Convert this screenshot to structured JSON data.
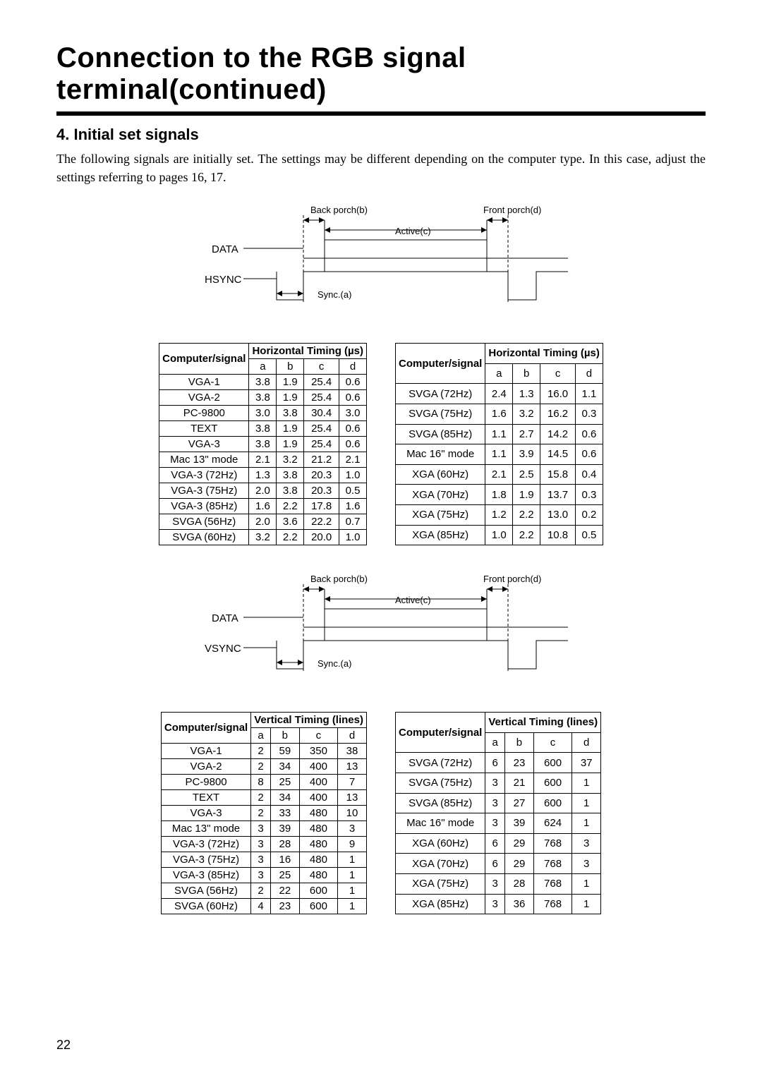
{
  "title": "Connection to the RGB signal terminal(continued)",
  "section_heading": "4. Initial set signals",
  "description": "The following signals are initially set. The settings may be different depending on the computer type. In this case, adjust the settings referring to pages 16, 17.",
  "page_number": "22",
  "diagram": {
    "back_porch": "Back porch(b)",
    "front_porch": "Front porch(d)",
    "active": "Active(c)",
    "sync": "Sync.(a)",
    "data_label": "DATA",
    "hsync_label": "HSYNC",
    "vsync_label": "VSYNC"
  },
  "tables": {
    "sig_header": "Computer/signal",
    "horiz_header": "Horizontal Timing (µs)",
    "vert_header": "Vertical Timing (lines)",
    "cols": [
      "a",
      "b",
      "c",
      "d"
    ],
    "horiz_left": [
      {
        "name": "VGA-1",
        "v": [
          "3.8",
          "1.9",
          "25.4",
          "0.6"
        ]
      },
      {
        "name": "VGA-2",
        "v": [
          "3.8",
          "1.9",
          "25.4",
          "0.6"
        ]
      },
      {
        "name": "PC-9800",
        "v": [
          "3.0",
          "3.8",
          "30.4",
          "3.0"
        ]
      },
      {
        "name": "TEXT",
        "v": [
          "3.8",
          "1.9",
          "25.4",
          "0.6"
        ]
      },
      {
        "name": "VGA-3",
        "v": [
          "3.8",
          "1.9",
          "25.4",
          "0.6"
        ]
      },
      {
        "name": "Mac 13\" mode",
        "v": [
          "2.1",
          "3.2",
          "21.2",
          "2.1"
        ]
      },
      {
        "name": "VGA-3 (72Hz)",
        "v": [
          "1.3",
          "3.8",
          "20.3",
          "1.0"
        ]
      },
      {
        "name": "VGA-3 (75Hz)",
        "v": [
          "2.0",
          "3.8",
          "20.3",
          "0.5"
        ]
      },
      {
        "name": "VGA-3 (85Hz)",
        "v": [
          "1.6",
          "2.2",
          "17.8",
          "1.6"
        ]
      },
      {
        "name": "SVGA (56Hz)",
        "v": [
          "2.0",
          "3.6",
          "22.2",
          "0.7"
        ]
      },
      {
        "name": "SVGA (60Hz)",
        "v": [
          "3.2",
          "2.2",
          "20.0",
          "1.0"
        ]
      }
    ],
    "horiz_right": [
      {
        "name": "SVGA (72Hz)",
        "v": [
          "2.4",
          "1.3",
          "16.0",
          "1.1"
        ]
      },
      {
        "name": "SVGA (75Hz)",
        "v": [
          "1.6",
          "3.2",
          "16.2",
          "0.3"
        ]
      },
      {
        "name": "SVGA (85Hz)",
        "v": [
          "1.1",
          "2.7",
          "14.2",
          "0.6"
        ]
      },
      {
        "name": "Mac 16\" mode",
        "v": [
          "1.1",
          "3.9",
          "14.5",
          "0.6"
        ]
      },
      {
        "name": "XGA (60Hz)",
        "v": [
          "2.1",
          "2.5",
          "15.8",
          "0.4"
        ]
      },
      {
        "name": "XGA (70Hz)",
        "v": [
          "1.8",
          "1.9",
          "13.7",
          "0.3"
        ]
      },
      {
        "name": "XGA (75Hz)",
        "v": [
          "1.2",
          "2.2",
          "13.0",
          "0.2"
        ]
      },
      {
        "name": "XGA (85Hz)",
        "v": [
          "1.0",
          "2.2",
          "10.8",
          "0.5"
        ]
      }
    ],
    "vert_left": [
      {
        "name": "VGA-1",
        "v": [
          "2",
          "59",
          "350",
          "38"
        ]
      },
      {
        "name": "VGA-2",
        "v": [
          "2",
          "34",
          "400",
          "13"
        ]
      },
      {
        "name": "PC-9800",
        "v": [
          "8",
          "25",
          "400",
          "7"
        ]
      },
      {
        "name": "TEXT",
        "v": [
          "2",
          "34",
          "400",
          "13"
        ]
      },
      {
        "name": "VGA-3",
        "v": [
          "2",
          "33",
          "480",
          "10"
        ]
      },
      {
        "name": "Mac 13\" mode",
        "v": [
          "3",
          "39",
          "480",
          "3"
        ]
      },
      {
        "name": "VGA-3 (72Hz)",
        "v": [
          "3",
          "28",
          "480",
          "9"
        ]
      },
      {
        "name": "VGA-3 (75Hz)",
        "v": [
          "3",
          "16",
          "480",
          "1"
        ]
      },
      {
        "name": "VGA-3 (85Hz)",
        "v": [
          "3",
          "25",
          "480",
          "1"
        ]
      },
      {
        "name": "SVGA (56Hz)",
        "v": [
          "2",
          "22",
          "600",
          "1"
        ]
      },
      {
        "name": "SVGA (60Hz)",
        "v": [
          "4",
          "23",
          "600",
          "1"
        ]
      }
    ],
    "vert_right": [
      {
        "name": "SVGA (72Hz)",
        "v": [
          "6",
          "23",
          "600",
          "37"
        ]
      },
      {
        "name": "SVGA (75Hz)",
        "v": [
          "3",
          "21",
          "600",
          "1"
        ]
      },
      {
        "name": "SVGA (85Hz)",
        "v": [
          "3",
          "27",
          "600",
          "1"
        ]
      },
      {
        "name": "Mac 16\" mode",
        "v": [
          "3",
          "39",
          "624",
          "1"
        ]
      },
      {
        "name": "XGA (60Hz)",
        "v": [
          "6",
          "29",
          "768",
          "3"
        ]
      },
      {
        "name": "XGA (70Hz)",
        "v": [
          "6",
          "29",
          "768",
          "3"
        ]
      },
      {
        "name": "XGA (75Hz)",
        "v": [
          "3",
          "28",
          "768",
          "1"
        ]
      },
      {
        "name": "XGA (85Hz)",
        "v": [
          "3",
          "36",
          "768",
          "1"
        ]
      }
    ]
  }
}
